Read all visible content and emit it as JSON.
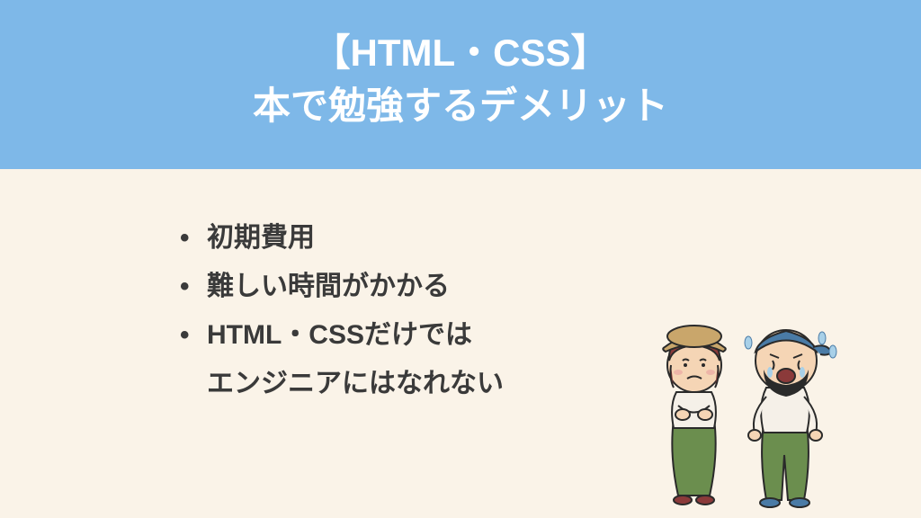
{
  "header": {
    "title_line1": "【HTML・CSS】",
    "title_line2": "本で勉強するデメリット"
  },
  "bullets": {
    "item1": "初期費用",
    "item2": "難しい時間がかかる",
    "item3_line1": "HTML・CSSだけでは",
    "item3_line2": "エンジニアにはなれない"
  }
}
